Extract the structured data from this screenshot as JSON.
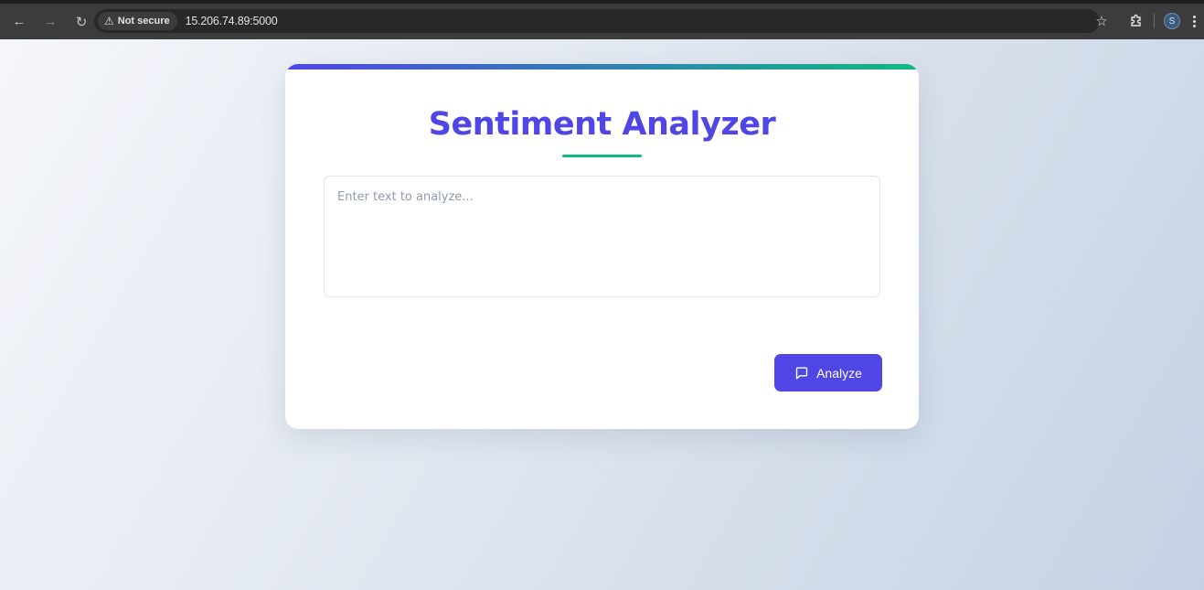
{
  "browser": {
    "security_label": "Not secure",
    "url": "15.206.74.89:5000",
    "profile_initial": "S",
    "icons": {
      "back": "arrow-left-icon",
      "forward": "arrow-right-icon",
      "reload": "reload-icon",
      "security": "warning-icon",
      "bookmark": "star-icon",
      "extensions": "puzzle-icon",
      "menu": "more-vertical-icon"
    }
  },
  "page": {
    "title": "Sentiment Analyzer",
    "input": {
      "placeholder": "Enter text to analyze...",
      "value": ""
    },
    "analyze_button": {
      "label": "Analyze",
      "icon": "message-square-icon"
    },
    "colors": {
      "primary": "#4f46e5",
      "accent": "#10b981"
    }
  }
}
